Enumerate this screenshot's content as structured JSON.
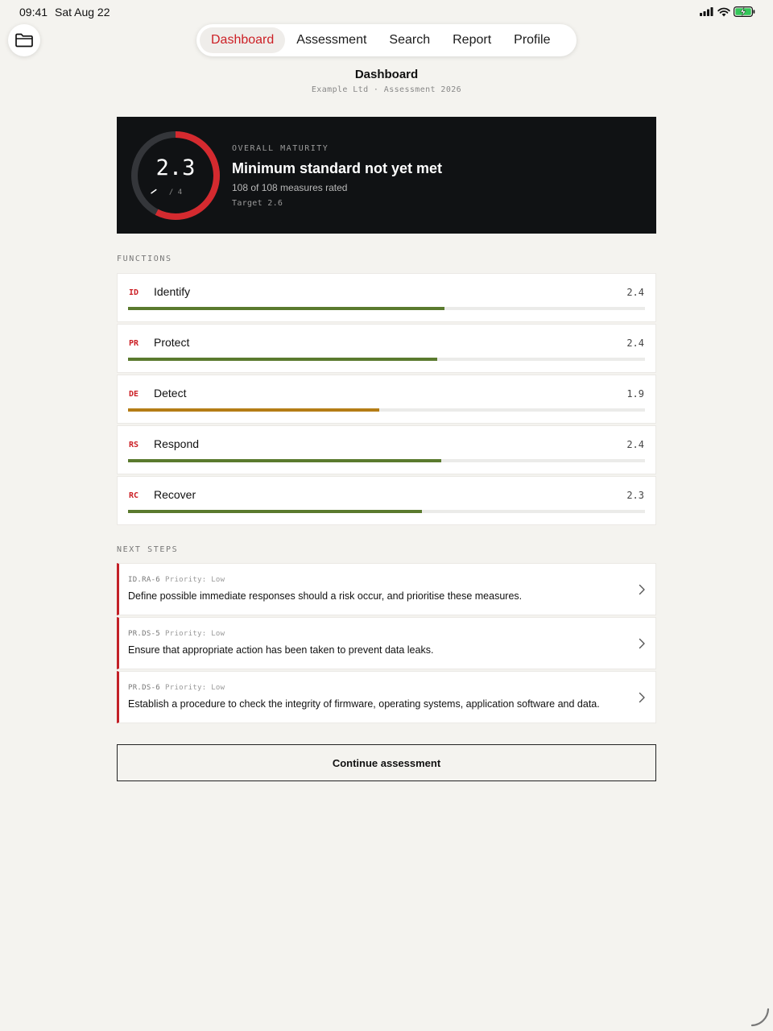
{
  "status_bar": {
    "time": "09:41",
    "date": "Sat Aug 22",
    "battery_color": "#34c759"
  },
  "nav": {
    "tabs": [
      {
        "label": "Dashboard",
        "active": true
      },
      {
        "label": "Assessment",
        "active": false
      },
      {
        "label": "Search",
        "active": false
      },
      {
        "label": "Report",
        "active": false
      },
      {
        "label": "Profile",
        "active": false
      }
    ],
    "folder_icon": "folder-icon"
  },
  "header": {
    "title": "Dashboard",
    "subtitle": "Example Ltd · Assessment 2026"
  },
  "overall": {
    "score": "2.3",
    "max": "/ 4",
    "score_value": 2.3,
    "max_value": 4,
    "target_value": 2.6,
    "kicker": "OVERALL MATURITY",
    "heading": "Minimum standard not yet met",
    "measures": "108 of 108 measures rated",
    "target": "Target 2.6",
    "gauge_color": "#d42a2f",
    "gauge_track_color": "#34363a"
  },
  "functions": {
    "label": "FUNCTIONS",
    "items": [
      {
        "code": "ID",
        "name": "Identify",
        "score": "2.4",
        "progress": 0.612,
        "color": "#5a7a2e"
      },
      {
        "code": "PR",
        "name": "Protect",
        "score": "2.4",
        "progress": 0.598,
        "color": "#5a7a2e"
      },
      {
        "code": "DE",
        "name": "Detect",
        "score": "1.9",
        "progress": 0.486,
        "color": "#b57d16"
      },
      {
        "code": "RS",
        "name": "Respond",
        "score": "2.4",
        "progress": 0.606,
        "color": "#5a7a2e"
      },
      {
        "code": "RC",
        "name": "Recover",
        "score": "2.3",
        "progress": 0.569,
        "color": "#5a7a2e"
      }
    ]
  },
  "next_steps": {
    "label": "NEXT STEPS",
    "items": [
      {
        "id": "ID.RA-6",
        "priority": "Priority: Low",
        "text": "Define possible immediate responses should a risk occur, and prioritise these measures."
      },
      {
        "id": "PR.DS-5",
        "priority": "Priority: Low",
        "text": "Ensure that appropriate action has been taken to prevent data leaks."
      },
      {
        "id": "PR.DS-6",
        "priority": "Priority: Low",
        "text": "Establish a procedure to check the integrity of firmware, operating systems, application software and data."
      }
    ]
  },
  "continue_label": "Continue assessment"
}
